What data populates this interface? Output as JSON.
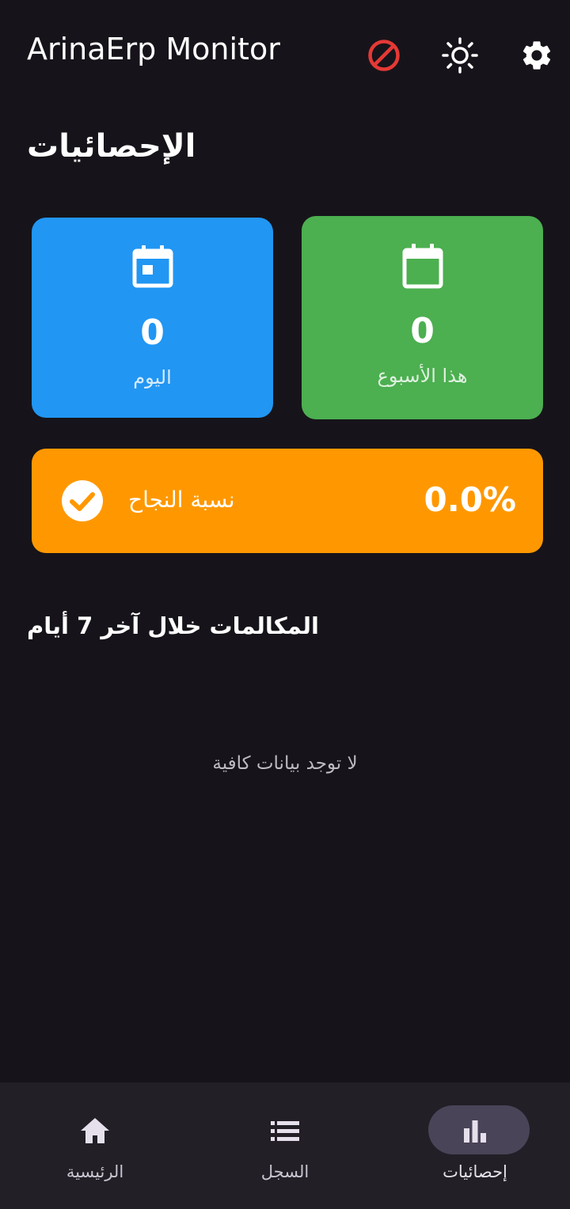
{
  "appbar": {
    "title": "ArinaErp Monitor",
    "icons": [
      "block-icon",
      "brightness-icon",
      "settings-icon"
    ],
    "block_color": "#e53935"
  },
  "page": {
    "title": "الإحصائيات"
  },
  "stats": {
    "today": {
      "value": "0",
      "label": "اليوم",
      "icon": "calendar-today-icon",
      "color": "#2196f3"
    },
    "week": {
      "value": "0",
      "label": "هذا الأسبوع",
      "icon": "calendar-icon",
      "color": "#4caf50"
    },
    "success": {
      "value": "0.0%",
      "label": "نسبة النجاح",
      "icon": "check-circle-icon",
      "color": "#ff9800"
    }
  },
  "calls": {
    "title": "المكالمات خلال آخر 7 أيام",
    "empty_text": "لا توجد بيانات كافية"
  },
  "bottom_nav": {
    "items": [
      {
        "label": "الرئيسية",
        "icon": "home-icon"
      },
      {
        "label": "السجل",
        "icon": "list-icon"
      },
      {
        "label": "إحصائيات",
        "icon": "bar-chart-icon",
        "selected": true
      }
    ]
  }
}
